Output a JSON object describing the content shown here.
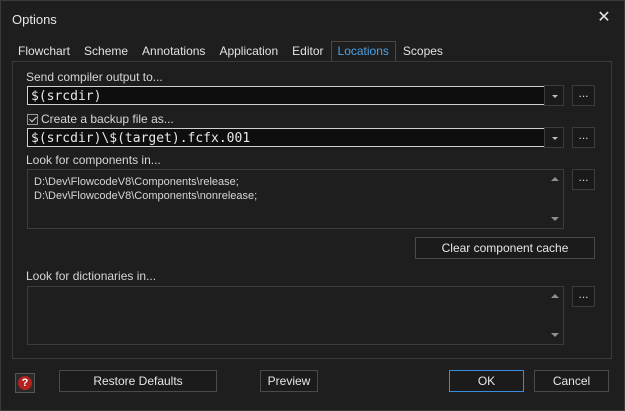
{
  "window": {
    "title": "Options"
  },
  "tabs": [
    {
      "label": "Flowchart"
    },
    {
      "label": "Scheme"
    },
    {
      "label": "Annotations"
    },
    {
      "label": "Application"
    },
    {
      "label": "Editor"
    },
    {
      "label": "Locations",
      "active": true
    },
    {
      "label": "Scopes"
    }
  ],
  "locations": {
    "compiler_output_label": "Send compiler output to...",
    "compiler_output_value": "$(srcdir)",
    "backup_checkbox_label": "Create a backup file as...",
    "backup_checked": true,
    "backup_value": "$(srcdir)\\$(target).fcfx.001",
    "components_label": "Look for components in...",
    "components_lines": [
      "D:\\Dev\\FlowcodeV8\\Components\\release;",
      "D:\\Dev\\FlowcodeV8\\Components\\nonrelease;"
    ],
    "clear_cache_label": "Clear component cache",
    "dictionaries_label": "Look for dictionaries in...",
    "browse_label": "..."
  },
  "footer": {
    "help_icon_text": "?",
    "restore_label": "Restore Defaults",
    "preview_label": "Preview",
    "ok_label": "OK",
    "cancel_label": "Cancel"
  },
  "colors": {
    "accent": "#3a8dde",
    "active_tab": "#4ea3e6",
    "background": "#1e1e1e",
    "help_icon": "#b52121"
  }
}
